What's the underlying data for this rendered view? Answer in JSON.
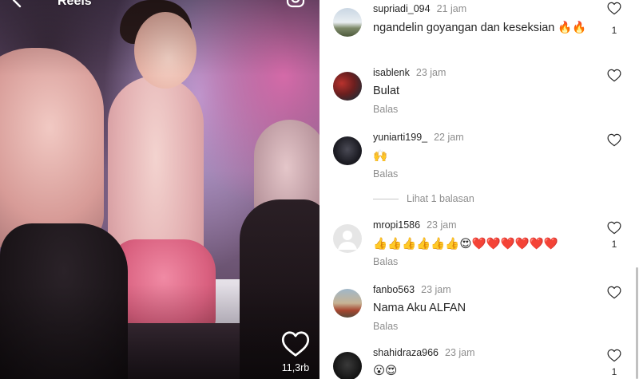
{
  "video": {
    "title": "Reels",
    "like_count": "11,3rb"
  },
  "comments": [
    {
      "username": "supriadi_094",
      "time": "21 jam",
      "text": "ngandelin goyangan dan keseksian 🔥🔥",
      "reply_label": "",
      "likes": "1",
      "avatar": "landscape-avatar"
    },
    {
      "username": "isablenk",
      "time": "23 jam",
      "text": "Bulat",
      "reply_label": "Balas",
      "likes": "",
      "avatar": "photo-avatar"
    },
    {
      "username": "yuniarti199_",
      "time": "22 jam",
      "text": "🙌",
      "reply_label": "Balas",
      "likes": "",
      "avatar": "dark-photo-avatar"
    },
    {
      "username": "mropi1586",
      "time": "23 jam",
      "text": "👍👍👍👍👍👍😍❤️❤️❤️❤️❤️❤️",
      "reply_label": "Balas",
      "likes": "1",
      "avatar": "default-avatar"
    },
    {
      "username": "fanbo563",
      "time": "23 jam",
      "text": "Nama Aku ALFAN",
      "reply_label": "Balas",
      "likes": "",
      "avatar": "outdoor-avatar"
    },
    {
      "username": "shahidraza966",
      "time": "23 jam",
      "text": "😮😍",
      "reply_label": "",
      "likes": "1",
      "avatar": "dark-avatar"
    }
  ],
  "view_replies_label": "Lihat 1 balasan",
  "icons": {
    "back": "back-arrow-icon",
    "camera": "camera-icon",
    "like": "heart-icon"
  },
  "colors": {
    "text": "#262626",
    "muted": "#8e8e8e"
  }
}
